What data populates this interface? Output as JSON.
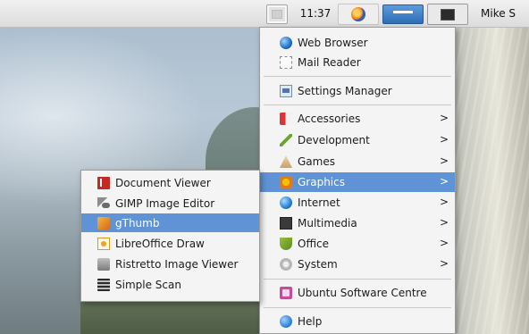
{
  "panel": {
    "clock": "11:37",
    "user": "Mike S",
    "icons": [
      "volume-icon",
      "wifi-icon",
      "menu-icon",
      "firefox-icon",
      "window-button",
      "terminal-icon"
    ]
  },
  "main_menu": {
    "items": [
      {
        "label": "Web Browser",
        "icon": "web-browser-icon"
      },
      {
        "label": "Mail Reader",
        "icon": "mail-reader-icon"
      },
      {
        "label": "Settings Manager",
        "icon": "settings-manager-icon"
      },
      {
        "label": "Accessories",
        "icon": "accessories-icon",
        "submenu": true
      },
      {
        "label": "Development",
        "icon": "development-icon",
        "submenu": true
      },
      {
        "label": "Games",
        "icon": "games-icon",
        "submenu": true
      },
      {
        "label": "Graphics",
        "icon": "graphics-icon",
        "submenu": true,
        "active": true
      },
      {
        "label": "Internet",
        "icon": "internet-icon",
        "submenu": true
      },
      {
        "label": "Multimedia",
        "icon": "multimedia-icon",
        "submenu": true
      },
      {
        "label": "Office",
        "icon": "office-icon",
        "submenu": true
      },
      {
        "label": "System",
        "icon": "system-icon",
        "submenu": true
      },
      {
        "label": "Ubuntu Software Centre",
        "icon": "ubuntu-software-centre-icon"
      },
      {
        "label": "Help",
        "icon": "help-icon"
      }
    ],
    "arrow": ">"
  },
  "graphics_submenu": {
    "items": [
      {
        "label": "Document Viewer",
        "icon": "document-viewer-icon"
      },
      {
        "label": "GIMP Image Editor",
        "icon": "gimp-icon"
      },
      {
        "label": "gThumb",
        "icon": "gthumb-icon",
        "active": true
      },
      {
        "label": "LibreOffice Draw",
        "icon": "libreoffice-draw-icon"
      },
      {
        "label": "Ristretto Image Viewer",
        "icon": "ristretto-icon"
      },
      {
        "label": "Simple Scan",
        "icon": "simple-scan-icon"
      }
    ]
  },
  "colors": {
    "highlight": "#5f93d6",
    "menu_bg": "#f4f4f4",
    "panel_bg": "#e6e6e6"
  }
}
